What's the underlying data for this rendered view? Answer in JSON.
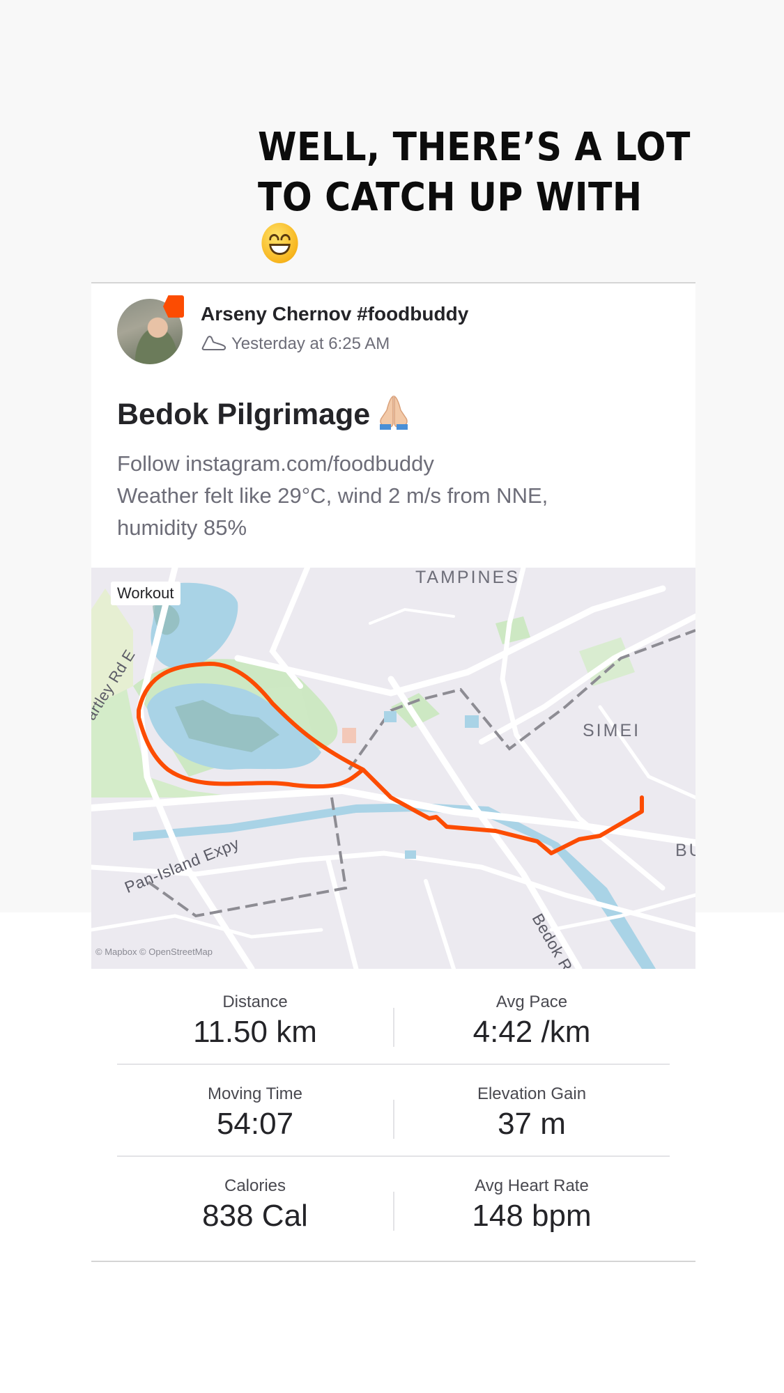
{
  "story": {
    "caption_line1": "WELL, THERE’S A LOT",
    "caption_line2": "TO CATCH UP WITH",
    "caption_emoji": "grinning-face-emoji"
  },
  "activity": {
    "athlete_name": "Arseny Chernov #foodbuddy",
    "timestamp": "Yesterday at 6:25 AM",
    "title": "Bedok Pilgrimage",
    "title_emoji": "folded-hands-emoji",
    "description_lines": [
      "Follow instagram.com/foodbuddy",
      "Weather felt like 29°C, wind 2 m/s from NNE,",
      "humidity 85%"
    ],
    "brand_color": "#fc4c02"
  },
  "map": {
    "tag": "Workout",
    "labels": {
      "tampines": "TAMPINES",
      "simei": "SIMEI",
      "bu": "BU",
      "bartley": "artley Rd E",
      "pie": "Pan-Island Expy",
      "bedok": "Bedok R"
    },
    "credit": "© Mapbox © OpenStreetMap",
    "route_color": "#fc4c02"
  },
  "stats": [
    {
      "left": {
        "label": "Distance",
        "value": "11.50 km"
      },
      "right": {
        "label": "Avg Pace",
        "value": "4:42 /km"
      }
    },
    {
      "left": {
        "label": "Moving Time",
        "value": "54:07"
      },
      "right": {
        "label": "Elevation Gain",
        "value": "37 m"
      }
    },
    {
      "left": {
        "label": "Calories",
        "value": "838 Cal"
      },
      "right": {
        "label": "Avg Heart Rate",
        "value": "148 bpm"
      }
    }
  ]
}
